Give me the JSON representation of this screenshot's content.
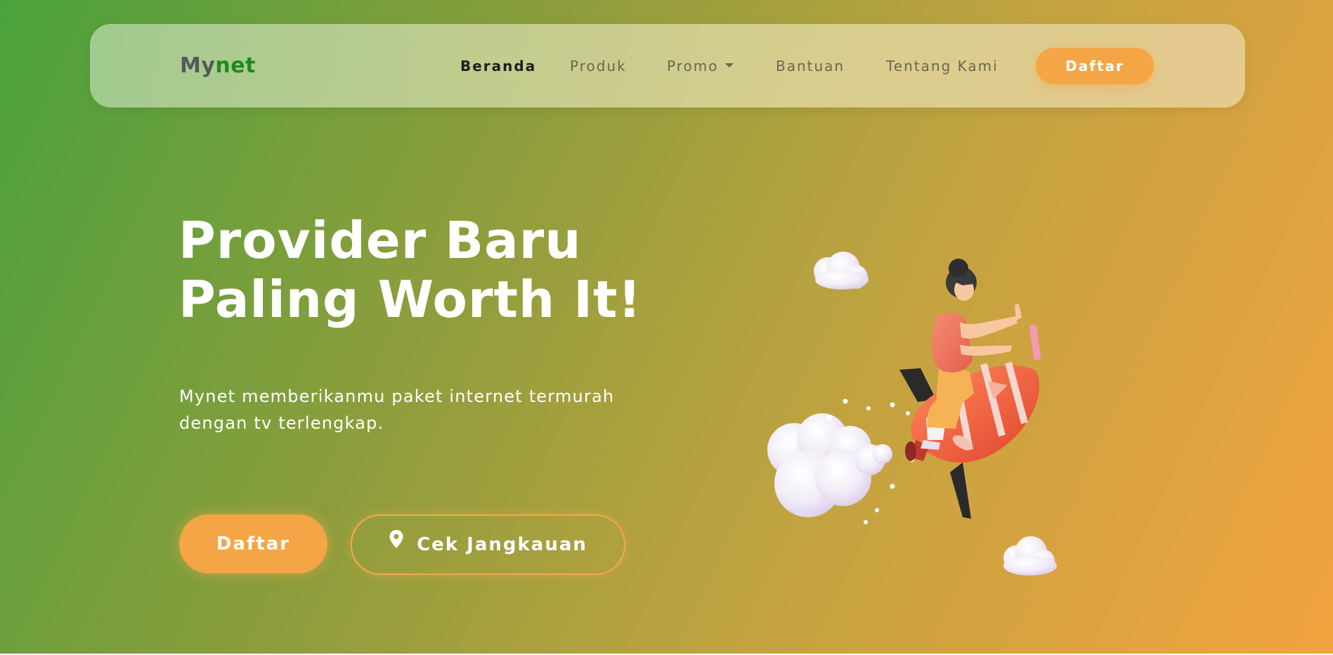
{
  "brand": {
    "part1": "My",
    "part2": "net"
  },
  "nav": {
    "items": [
      {
        "label": "Beranda",
        "active": true
      },
      {
        "label": "Produk",
        "active": false
      },
      {
        "label": "Promo",
        "active": false,
        "has_dropdown": true
      },
      {
        "label": "Bantuan",
        "active": false
      },
      {
        "label": "Tentang Kami",
        "active": false
      }
    ],
    "cta_label": "Daftar"
  },
  "hero": {
    "headline_line1": "Provider Baru",
    "headline_line2": "Paling Worth It!",
    "subtitle_line1": "Mynet memberikanmu paket internet termurah",
    "subtitle_line2": "dengan tv terlengkap.",
    "primary_button": "Daftar",
    "secondary_button": "Cek Jangkauan"
  },
  "icons": {
    "secondary_button_icon": "map-pin-icon",
    "dropdown_icon": "caret-down-icon"
  },
  "colors": {
    "accent_orange": "#f4a545",
    "brand_green": "#1e8a1e",
    "gradient_start": "#4aa23c",
    "gradient_end": "#f3a340"
  }
}
